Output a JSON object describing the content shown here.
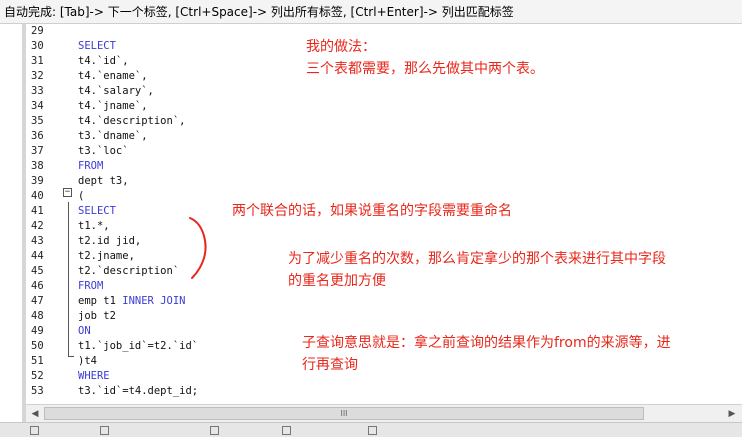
{
  "hint_bar": {
    "text": "自动完成: [Tab]-> 下一个标签, [Ctrl+Space]-> 列出所有标签, [Ctrl+Enter]-> 列出匹配标签"
  },
  "editor": {
    "lines": [
      {
        "num": "29",
        "code": ""
      },
      {
        "num": "30",
        "code": "SELECT",
        "kw": true
      },
      {
        "num": "31",
        "code": "t4.`id`,"
      },
      {
        "num": "32",
        "code": "t4.`ename`,"
      },
      {
        "num": "33",
        "code": "t4.`salary`,"
      },
      {
        "num": "34",
        "code": "t4.`jname`,"
      },
      {
        "num": "35",
        "code": "t4.`description`,"
      },
      {
        "num": "36",
        "code": "t3.`dname`,"
      },
      {
        "num": "37",
        "code": "t3.`loc`"
      },
      {
        "num": "38",
        "code": "FROM",
        "kw": true
      },
      {
        "num": "39",
        "code": "dept t3,"
      },
      {
        "num": "40",
        "code": "("
      },
      {
        "num": "41",
        "code": "SELECT",
        "kw": true
      },
      {
        "num": "42",
        "code": "t1.*,"
      },
      {
        "num": "43",
        "code": "t2.id jid,"
      },
      {
        "num": "44",
        "code": "t2.jname,"
      },
      {
        "num": "45",
        "code": "t2.`description`"
      },
      {
        "num": "46",
        "code": "FROM",
        "kw": true
      },
      {
        "num": "47",
        "code_pre": "emp t1 ",
        "code_kw": "INNER JOIN"
      },
      {
        "num": "48",
        "code": "job t2"
      },
      {
        "num": "49",
        "code": "ON",
        "kw": true
      },
      {
        "num": "50",
        "code": "t1.`job_id`=t2.`id`"
      },
      {
        "num": "51",
        "code": ")t4"
      },
      {
        "num": "52",
        "code": "WHERE",
        "kw": true
      },
      {
        "num": "53",
        "code": "t3.`id`=t4.dept_id;"
      }
    ]
  },
  "notes": {
    "note1_line1": "我的做法：",
    "note1_line2": "三个表都需要，那么先做其中两个表。",
    "note2": "两个联合的话，如果说重名的字段需要重命名",
    "note3_line1": "为了减少重名的次数，那么肯定拿少的那个表来进行其中字段",
    "note3_line2": "的重名更加方便",
    "note4_line1": "子查询意思就是：拿之前查询的结果作为from的来源等，进",
    "note4_line2": "行再查询"
  },
  "colors": {
    "keyword": "#3b3bd6",
    "note": "#e8271b"
  },
  "scrollbar": {
    "thumb_grip": "III"
  }
}
